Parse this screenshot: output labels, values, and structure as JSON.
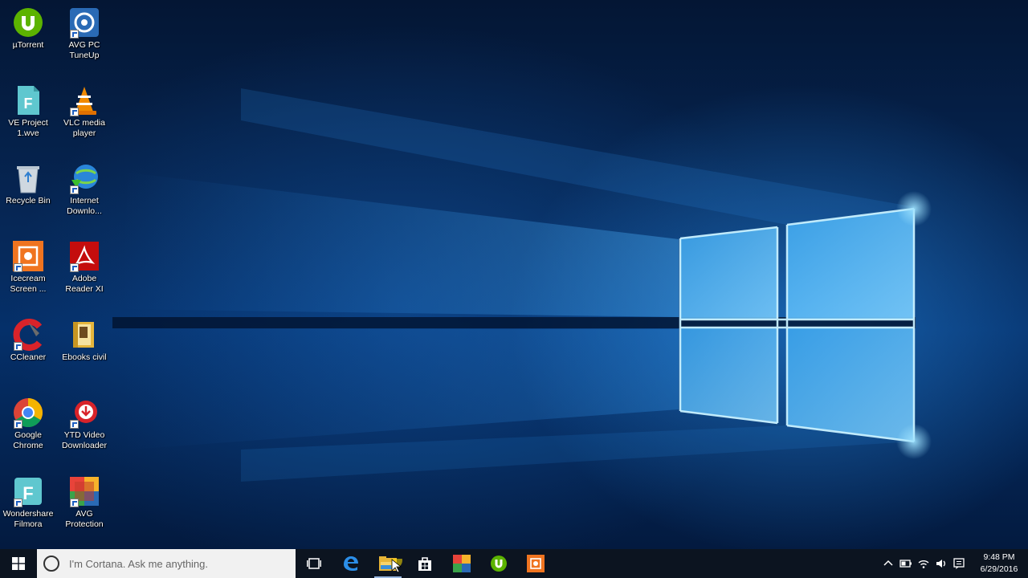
{
  "desktop": {
    "icons": [
      {
        "label": "µTorrent",
        "icon": "utorrent-icon",
        "shortcut": false
      },
      {
        "label": "AVG PC\nTuneUp",
        "icon": "avg-tuneup-icon",
        "shortcut": true
      },
      {
        "label": "VE Project\n1.wve",
        "icon": "filmora-project-icon",
        "shortcut": false
      },
      {
        "label": "VLC media\nplayer",
        "icon": "vlc-icon",
        "shortcut": true
      },
      {
        "label": "Recycle Bin",
        "icon": "recycle-bin-icon",
        "shortcut": false
      },
      {
        "label": "Internet\nDownlo...",
        "icon": "internet-download-manager-icon",
        "shortcut": true
      },
      {
        "label": "Icecream\nScreen ...",
        "icon": "icecream-screen-recorder-icon",
        "shortcut": true
      },
      {
        "label": "Adobe\nReader XI",
        "icon": "adobe-reader-icon",
        "shortcut": true
      },
      {
        "label": "CCleaner",
        "icon": "ccleaner-icon",
        "shortcut": true
      },
      {
        "label": "Ebooks civil",
        "icon": "folder-icon",
        "shortcut": false
      },
      {
        "label": "Google\nChrome",
        "icon": "chrome-icon",
        "shortcut": true
      },
      {
        "label": "YTD Video\nDownloader",
        "icon": "ytd-downloader-icon",
        "shortcut": true
      },
      {
        "label": "Wondershare\nFilmora",
        "icon": "filmora-icon",
        "shortcut": true
      },
      {
        "label": "AVG\nProtection",
        "icon": "avg-protection-icon",
        "shortcut": true
      }
    ]
  },
  "taskbar": {
    "cortana_placeholder": "I'm Cortana. Ask me anything.",
    "pinned": [
      {
        "icon": "task-view-icon"
      },
      {
        "icon": "edge-icon"
      },
      {
        "icon": "file-explorer-icon",
        "active": true
      },
      {
        "icon": "store-icon"
      },
      {
        "icon": "avg-taskbar-icon"
      },
      {
        "icon": "utorrent-taskbar-icon"
      },
      {
        "icon": "icecream-taskbar-icon"
      }
    ],
    "clock": {
      "time": "9:48 PM",
      "date": "6/29/2016"
    }
  },
  "colors": {
    "taskbar": "#0c1420",
    "cortana_box": "#f1f1f1",
    "window_light": "#7fd6ff"
  }
}
